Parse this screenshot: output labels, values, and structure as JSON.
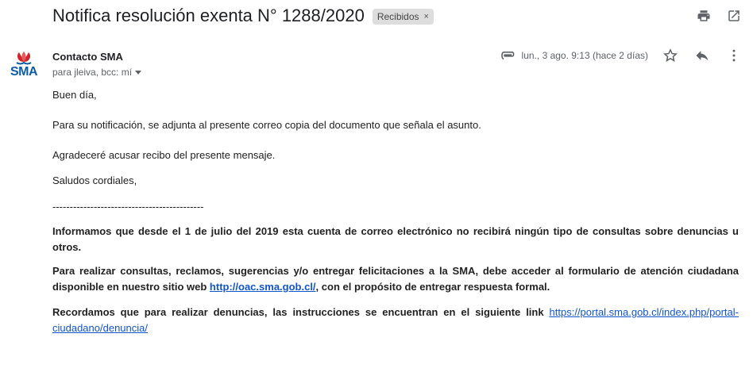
{
  "email": {
    "subject": "Notifica resolución exenta N° 1288/2020",
    "label_chip": "Recibidos",
    "label_remove": "×",
    "avatar_text": "SMA",
    "sender_name": "Contacto SMA",
    "recipients": "para jleiva, bcc: mí",
    "date": "lun., 3 ago. 9:13 (hace 2 días)",
    "body": {
      "greeting": "Buen día,",
      "line1": "Para su notificación, se adjunta al presente correo copia del documento que señala el asunto.",
      "line2": "Agradeceré acusar recibo del presente mensaje.",
      "closing": "Saludos cordiales,",
      "separator": "--------------------------------------------",
      "notice1": "Informamos que desde el 1 de julio del 2019 esta cuenta de correo electrónico no recibirá ningún tipo de consultas sobre denuncias u otros.",
      "notice2_pre": "Para realizar consultas, reclamos, sugerencias y/o entregar felicitaciones a la SMA, debe acceder al formulario de atención ciudadana disponible en nuestro sitio web ",
      "notice2_link": "http://oac.sma.gob.cl/",
      "notice2_post": ", con el propósito de entregar respuesta formal.",
      "notice3_pre": "Recordamos que para realizar denuncias, las instrucciones se encuentran en el siguiente link ",
      "notice3_link": "https://portal.sma.gob.cl/index.php/portal-ciudadano/denuncia/"
    }
  },
  "icons": {
    "print": "print-icon",
    "open_new_window": "open-in-new-icon",
    "attachment": "paperclip-icon",
    "star": "star-icon",
    "reply": "reply-icon",
    "more": "more-vert-icon"
  },
  "colors": {
    "link": "#1155cc",
    "chip_bg": "#dddddd",
    "avatar_red": "#d2232a",
    "avatar_blue": "#0b5da8"
  }
}
